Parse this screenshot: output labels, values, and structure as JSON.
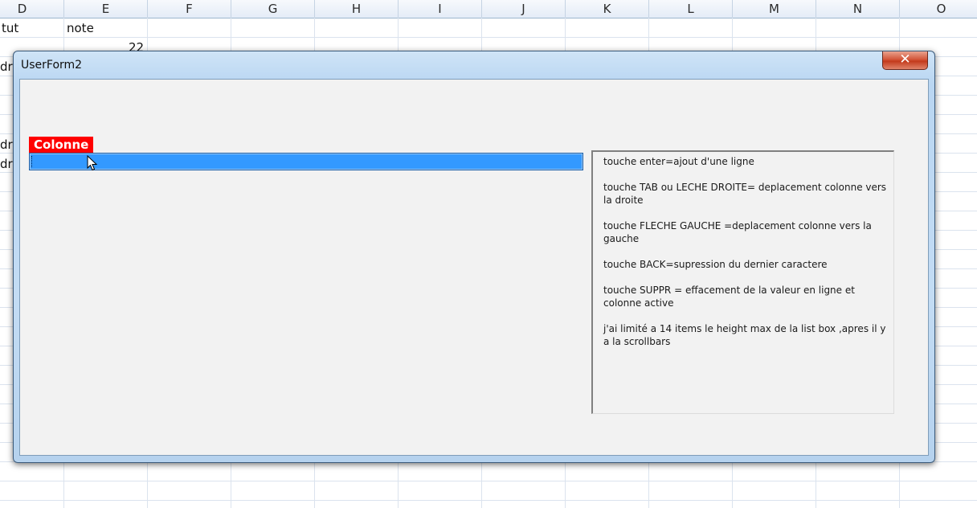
{
  "spreadsheet": {
    "columns": [
      "D",
      "E",
      "F",
      "G",
      "H",
      "I",
      "J",
      "K",
      "L",
      "M",
      "N",
      "O"
    ],
    "cells": {
      "d1": "tut",
      "e1": "note",
      "e2": "22",
      "d3": "dre",
      "d6": "dre",
      "d7": "dre"
    }
  },
  "userform": {
    "title": "UserForm2",
    "close_icon": "close-x-icon",
    "close_glyph": "✕",
    "label": "Colonne",
    "input_value": "",
    "help_lines": [
      "touche enter=ajout d'une ligne",
      "touche TAB ou LECHE DROITE= deplacement colonne vers la droite",
      "touche FLECHE GAUCHE =deplacement colonne vers la gauche",
      "touche BACK=supression du dernier caractere",
      "touche SUPPR = effacement de la valeur en ligne et colonne active",
      "j'ai limité a 14 items le height max de la list box ,apres il y a la scrollbars"
    ]
  },
  "colors": {
    "label_bg": "#ff0000",
    "input_selected_bg": "#3399ff",
    "client_bg": "#f2f2f2",
    "close_button": "#c33a1c"
  }
}
